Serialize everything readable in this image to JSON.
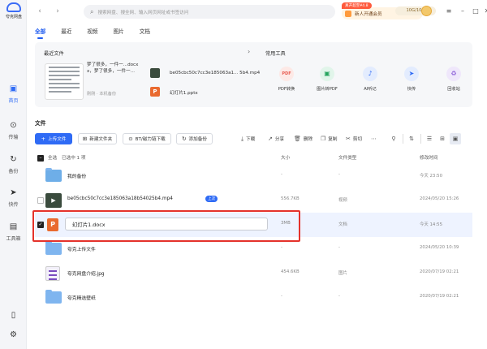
{
  "app": {
    "logo_text": "夸克网盘"
  },
  "colors": {
    "accent": "#2f6bf5",
    "highlight_border": "#e4322b",
    "folder": "#7fb5ef"
  },
  "sidebar": {
    "items": [
      {
        "label": "首页",
        "icon": "home-icon",
        "glyph": "▣"
      },
      {
        "label": "传输",
        "icon": "transfer-icon",
        "glyph": "⊙"
      },
      {
        "label": "备份",
        "icon": "backup-icon",
        "glyph": "↻"
      },
      {
        "label": "快传",
        "icon": "quick-transfer-icon",
        "glyph": "➤"
      },
      {
        "label": "工具箱",
        "icon": "toolbox-icon",
        "glyph": "▤"
      }
    ]
  },
  "topbar": {
    "search_placeholder": "搜索网盘、搜全网、输入网页网址或书签访问",
    "promo_tag": "真开超至¥4.8",
    "promo_label": "新人开通会员",
    "quota": "10G/10G"
  },
  "tabs": [
    "全部",
    "最近",
    "视频",
    "图片",
    "文档"
  ],
  "recent": {
    "title": "最近文件",
    "doc_name": "梦了很多，一件一...docx",
    "doc_name2": "x，梦了很多，一件一...",
    "doc_meta": "刚刚 · 本机备份",
    "files": [
      {
        "name": "be05cbc50c7cc3e185063a1... 5b4.mp4",
        "icon": "video-icon"
      },
      {
        "name": "幻灯片1.pptx",
        "icon": "ppt-icon"
      }
    ]
  },
  "tools": {
    "title": "常用工具",
    "items": [
      {
        "label": "PDF转换",
        "glyph": "PDF",
        "color": "#e85a4f",
        "bg": "#fde9e6"
      },
      {
        "label": "图片转PDF",
        "glyph": "▣",
        "color": "#27a55f",
        "bg": "#e1f5ea"
      },
      {
        "label": "AI听记",
        "glyph": "♪",
        "color": "#2f6bf5",
        "bg": "#e3ecfe"
      },
      {
        "label": "快传",
        "glyph": "➤",
        "color": "#2f6bf5",
        "bg": "#e3ecfe"
      },
      {
        "label": "回收站",
        "glyph": "♻",
        "color": "#8c5ed8",
        "bg": "#efe7fb"
      }
    ]
  },
  "files_section": {
    "title": "文件"
  },
  "toolbar": {
    "upload": "上传文件",
    "new_folder": "新建文件夹",
    "bt": "BT/磁力链下载",
    "add_backup": "添加备份",
    "download": "下载",
    "share": "分享",
    "delete": "删除",
    "copy": "复制",
    "cut": "剪切"
  },
  "table": {
    "select_all": "全选",
    "selected": "已选中 1 项",
    "col_size": "大小",
    "col_type": "文件类型",
    "col_date": "修改时间",
    "rows": [
      {
        "name": "我的备份",
        "size": "-",
        "type": "-",
        "date": "今天 23:50",
        "kind": "folder-backup"
      },
      {
        "name": "be05cbc50c7cc3e185063a18b54025b4.mp4",
        "size": "556.7KB",
        "type": "视频",
        "date": "2024/05/20 15:26",
        "kind": "video",
        "badge": "上次"
      },
      {
        "name": "幻灯片1.docx",
        "size": "3MB",
        "type": "文档",
        "date": "今天 14:55",
        "kind": "ppt"
      },
      {
        "name": "夸克上传文件",
        "size": "-",
        "type": "-",
        "date": "2024/05/20 10:39",
        "kind": "folder"
      },
      {
        "name": "夸克网盘介绍.jpg",
        "size": "454.6KB",
        "type": "图片",
        "date": "2020/07/19 02:21",
        "kind": "image"
      },
      {
        "name": "夸克精选壁纸",
        "size": "-",
        "type": "-",
        "date": "2020/07/19 02:21",
        "kind": "folder"
      }
    ]
  }
}
